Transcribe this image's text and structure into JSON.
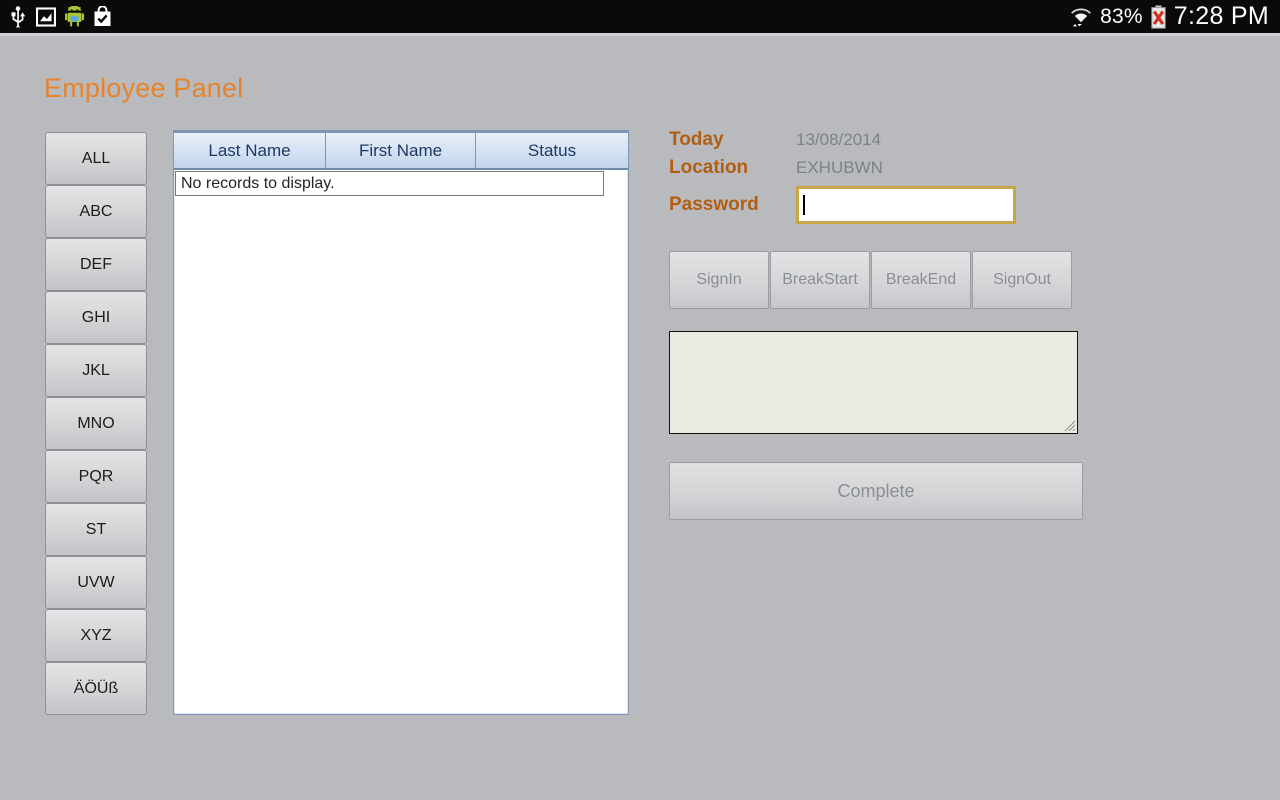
{
  "status_bar": {
    "left_icons": [
      "usb-icon",
      "screenshot-icon",
      "android-robot-icon",
      "play-store-bag-icon"
    ],
    "wifi_icon": "wifi-icon",
    "battery_percent": "83%",
    "battery_icon": "battery-error-icon",
    "time": "7:28 PM"
  },
  "page": {
    "title": "Employee Panel",
    "title_color": "#e8832a",
    "background_color": "#b8babe"
  },
  "alpha_filter": {
    "buttons": [
      {
        "label": "ALL"
      },
      {
        "label": "ABC"
      },
      {
        "label": "DEF"
      },
      {
        "label": "GHI"
      },
      {
        "label": "JKL"
      },
      {
        "label": "MNO"
      },
      {
        "label": "PQR"
      },
      {
        "label": "ST"
      },
      {
        "label": "UVW"
      },
      {
        "label": "XYZ"
      },
      {
        "label": "ÄÖÜß"
      }
    ]
  },
  "employee_table": {
    "columns": [
      "Last Name",
      "First Name",
      "Status"
    ],
    "rows": [],
    "empty_message": "No records to display.",
    "header_text_color": "#1f3864"
  },
  "details": {
    "today_label": "Today",
    "today_value": "13/08/2014",
    "location_label": "Location",
    "location_value": "EXHUBWN",
    "password_label": "Password",
    "password_value": "",
    "label_color": "#b35f12",
    "value_color": "#7e8288",
    "password_border_color": "#c9a648"
  },
  "actions": {
    "buttons": [
      {
        "label": "SignIn",
        "enabled": false
      },
      {
        "label": "BreakStart",
        "enabled": false
      },
      {
        "label": "BreakEnd",
        "enabled": false
      },
      {
        "label": "SignOut",
        "enabled": false
      }
    ]
  },
  "notes": {
    "value": "",
    "background_color": "#eaeae2"
  },
  "complete": {
    "label": "Complete",
    "enabled": false
  }
}
